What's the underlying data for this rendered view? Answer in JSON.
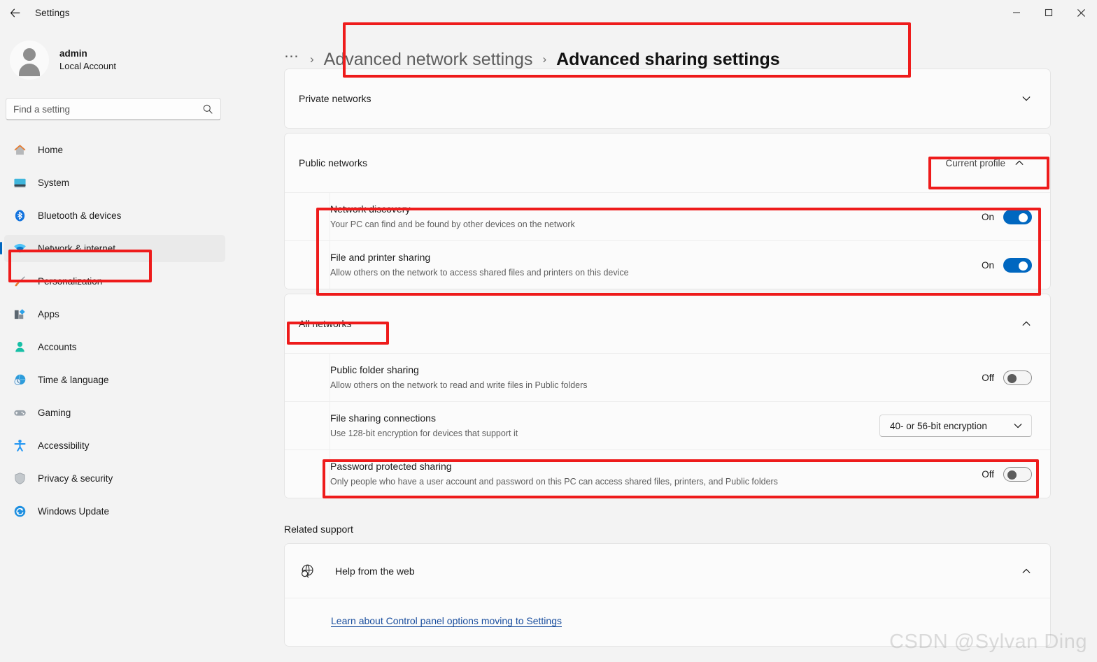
{
  "window": {
    "title": "Settings",
    "back_icon": "arrow-left-icon",
    "controls": [
      {
        "name": "minimize",
        "icon": "minimize-icon"
      },
      {
        "name": "maximize",
        "icon": "maximize-icon"
      },
      {
        "name": "close",
        "icon": "close-icon"
      }
    ]
  },
  "account": {
    "name": "admin",
    "type": "Local Account",
    "avatar_icon": "person-avatar-icon"
  },
  "search": {
    "placeholder": "Find a setting",
    "value": "",
    "icon": "search-icon"
  },
  "sidebar": {
    "items": [
      {
        "label": "Home",
        "icon": "home-icon",
        "selected": false
      },
      {
        "label": "System",
        "icon": "monitor-icon",
        "selected": false
      },
      {
        "label": "Bluetooth & devices",
        "icon": "bluetooth-icon",
        "selected": false
      },
      {
        "label": "Network & internet",
        "icon": "wifi-icon",
        "selected": true
      },
      {
        "label": "Personalization",
        "icon": "paintbrush-icon",
        "selected": false
      },
      {
        "label": "Apps",
        "icon": "apps-icon",
        "selected": false
      },
      {
        "label": "Accounts",
        "icon": "account-icon",
        "selected": false
      },
      {
        "label": "Time & language",
        "icon": "clock-globe-icon",
        "selected": false
      },
      {
        "label": "Gaming",
        "icon": "gamepad-icon",
        "selected": false
      },
      {
        "label": "Accessibility",
        "icon": "accessibility-icon",
        "selected": false
      },
      {
        "label": "Privacy & security",
        "icon": "shield-icon",
        "selected": false
      },
      {
        "label": "Windows Update",
        "icon": "update-icon",
        "selected": false
      }
    ]
  },
  "breadcrumb": {
    "overflow": "⋯",
    "separator": "›",
    "parent": "Advanced network settings",
    "current": "Advanced sharing settings"
  },
  "private_networks": {
    "title": "Private networks",
    "chevron": "chevron-down-icon",
    "expanded": false
  },
  "public_networks": {
    "title": "Public networks",
    "profile_badge": "Current profile",
    "chevron": "chevron-up-icon",
    "expanded": true,
    "rows": [
      {
        "title": "Network discovery",
        "subtitle": "Your PC can find and be found by other devices on the network",
        "state_label": "On",
        "state": "on"
      },
      {
        "title": "File and printer sharing",
        "subtitle": "Allow others on the network to access shared files and printers on this device",
        "state_label": "On",
        "state": "on"
      }
    ]
  },
  "all_networks": {
    "title": "All networks",
    "chevron": "chevron-up-icon",
    "expanded": true,
    "rows": [
      {
        "title": "Public folder sharing",
        "subtitle": "Allow others on the network to read and write files in Public folders",
        "control": "toggle",
        "state_label": "Off",
        "state": "off"
      },
      {
        "title": "File sharing connections",
        "subtitle": "Use 128-bit encryption for devices that support it",
        "control": "dropdown",
        "dropdown_value": "40- or 56-bit encryption",
        "dropdown_icon": "chevron-down-icon"
      },
      {
        "title": "Password protected sharing",
        "subtitle": "Only people who have a user account and password on this PC can access shared files, printers, and Public folders",
        "control": "toggle",
        "state_label": "Off",
        "state": "off"
      }
    ]
  },
  "related_support": {
    "section_label": "Related support",
    "help_title": "Help from the web",
    "help_icon": "globe-search-icon",
    "chevron": "chevron-up-icon",
    "link_text": "Learn about Control panel options moving to Settings"
  },
  "watermark": {
    "text": "CSDN @Sylvan Ding"
  },
  "colors": {
    "accent": "#0067C0",
    "annotation": "#EE1B1B",
    "link": "#1A4E9E",
    "page_bg": "#F3F3F3",
    "card_bg": "#FBFBFB"
  }
}
